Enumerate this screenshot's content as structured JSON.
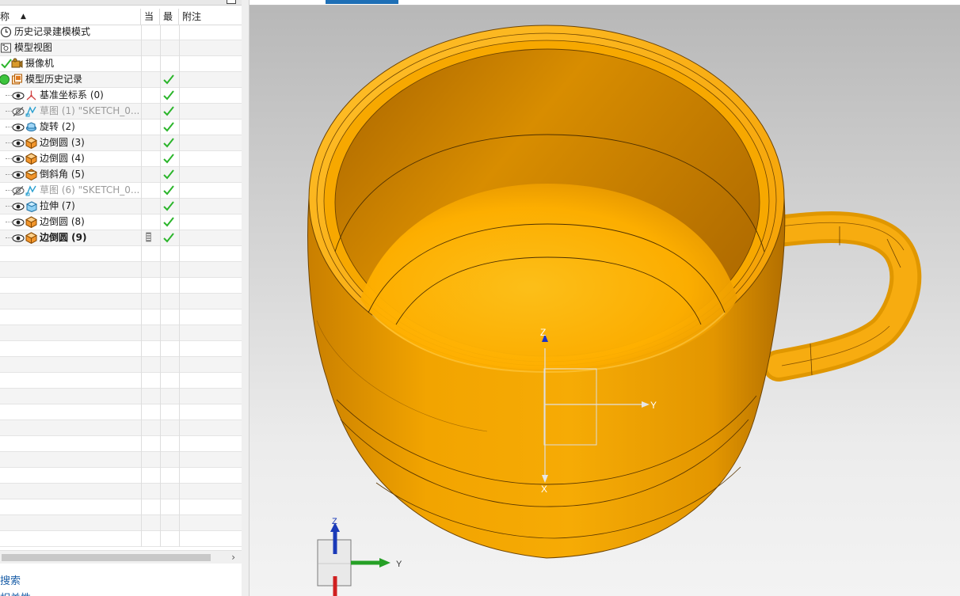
{
  "navigator": {
    "columns": {
      "name": "称",
      "sort_indicator": "▲",
      "current": "当",
      "latest": "最",
      "notes": "附注"
    },
    "rows": [
      {
        "label": "历史记录建模模式",
        "icon": "clock-icon",
        "level": 0,
        "visible": null,
        "latest_check": false,
        "dim": false,
        "bold": false
      },
      {
        "label": "模型视图",
        "icon": "model-view-icon",
        "level": 0,
        "visible": null,
        "latest_check": false,
        "dim": false,
        "bold": false
      },
      {
        "label": "摄像机",
        "icon": "camera-icon",
        "level": 0,
        "visible": null,
        "latest_check": false,
        "dim": false,
        "bold": false
      },
      {
        "label": "模型历史记录",
        "icon": "model-history-icon",
        "level": 0,
        "visible": null,
        "latest_check": true,
        "dim": false,
        "bold": false
      },
      {
        "label": "基准坐标系 (0)",
        "icon": "datum-csys-icon",
        "level": 1,
        "visible": true,
        "latest_check": true,
        "dim": false,
        "bold": false
      },
      {
        "label": "草图 (1) \"SKETCH_0...",
        "icon": "sketch-icon",
        "level": 1,
        "visible": false,
        "latest_check": true,
        "dim": true,
        "bold": false
      },
      {
        "label": "旋转 (2)",
        "icon": "revolve-icon",
        "level": 1,
        "visible": true,
        "latest_check": true,
        "dim": false,
        "bold": false
      },
      {
        "label": "边倒圆 (3)",
        "icon": "edge-blend-icon",
        "level": 1,
        "visible": true,
        "latest_check": true,
        "dim": false,
        "bold": false
      },
      {
        "label": "边倒圆 (4)",
        "icon": "edge-blend-icon",
        "level": 1,
        "visible": true,
        "latest_check": true,
        "dim": false,
        "bold": false
      },
      {
        "label": "倒斜角 (5)",
        "icon": "chamfer-icon",
        "level": 1,
        "visible": true,
        "latest_check": true,
        "dim": false,
        "bold": false
      },
      {
        "label": "草图 (6) \"SKETCH_0...",
        "icon": "sketch-icon",
        "level": 1,
        "visible": false,
        "latest_check": true,
        "dim": true,
        "bold": false
      },
      {
        "label": "拉伸 (7)",
        "icon": "extrude-icon",
        "level": 1,
        "visible": true,
        "latest_check": true,
        "dim": false,
        "bold": false
      },
      {
        "label": "边倒圆 (8)",
        "icon": "edge-blend-icon",
        "level": 1,
        "visible": true,
        "latest_check": true,
        "dim": false,
        "bold": false
      },
      {
        "label": "边倒圆 (9)",
        "icon": "edge-blend-icon",
        "level": 1,
        "visible": true,
        "latest_check": true,
        "dim": false,
        "bold": true,
        "current_marker": true
      }
    ],
    "search_label": "搜索",
    "related_label": "相关性"
  },
  "viewport": {
    "csys_labels": {
      "z": "Z",
      "y": "Y",
      "x": "X"
    },
    "triad_labels": {
      "z": "Z",
      "y": "Y"
    },
    "body_color": "#f7a800"
  },
  "colors": {
    "accent": "#1e6fb6",
    "check": "#2bb52b",
    "link": "#1b5fa8"
  }
}
